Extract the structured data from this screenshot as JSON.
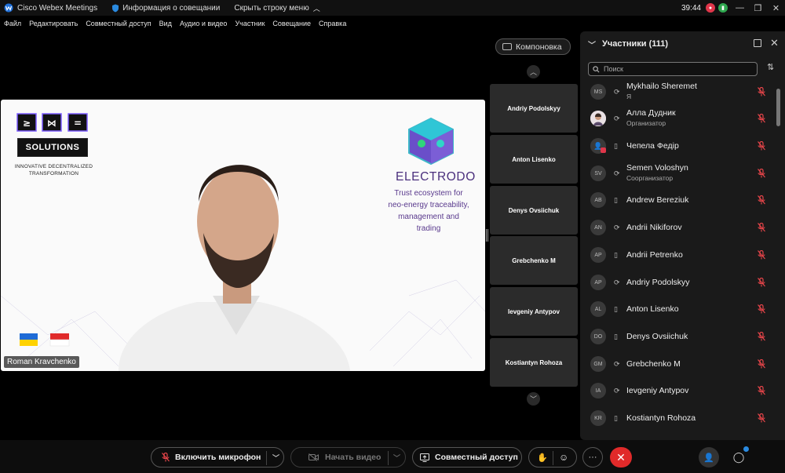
{
  "titlebar": {
    "app_title": "Cisco Webex Meetings",
    "meeting_info": "Информация о совещании",
    "hide_menu": "Скрыть строку меню",
    "clock": "39:44"
  },
  "menu": [
    "Файл",
    "Редактировать",
    "Совместный доступ",
    "Вид",
    "Аудио и видео",
    "Участник",
    "Совещание",
    "Справка"
  ],
  "layout_button": "Компоновка",
  "main_video": {
    "speaker_name": "Roman Kravchenko",
    "slide": {
      "solutions": "SOLUTIONS",
      "tagline_1": "INNOVATIVE DECENTRALIZED",
      "tagline_2": "TRANSFORMATION",
      "electrodo_title": "ELECTRODO",
      "electrodo_sub_1": "Trust ecosystem for",
      "electrodo_sub_2": "neo-energy  traceability,",
      "electrodo_sub_3": "management and",
      "electrodo_sub_4": "trading"
    }
  },
  "thumbnails": [
    "Andriy Podolskyy",
    "Anton Lisenko",
    "Denys Ovsiichuk",
    "Grebchenko M",
    "Ievgeniy Antypov",
    "Kostiantyn Rohoza"
  ],
  "panel": {
    "title": "Участники (111)",
    "search_placeholder": "Поиск",
    "participants": [
      {
        "initials": "MS",
        "name": "Mykhailo Sheremet",
        "role": "Я",
        "device": "sync"
      },
      {
        "initials": "",
        "name": "Алла Дудник",
        "role": "Организатор",
        "device": "sync"
      },
      {
        "initials": "",
        "name": "Чепела Федір",
        "role": "",
        "device": "phone"
      },
      {
        "initials": "SV",
        "name": "Semen Voloshyn",
        "role": "Соорганизатор",
        "device": "sync"
      },
      {
        "initials": "AB",
        "name": "Andrew Bereziuk",
        "role": "",
        "device": "phone"
      },
      {
        "initials": "AN",
        "name": "Andrii Nikiforov",
        "role": "",
        "device": "sync"
      },
      {
        "initials": "AP",
        "name": "Andrii Petrenko",
        "role": "",
        "device": "phone"
      },
      {
        "initials": "AP",
        "name": "Andriy Podolskyy",
        "role": "",
        "device": "sync"
      },
      {
        "initials": "AL",
        "name": "Anton Lisenko",
        "role": "",
        "device": "phone"
      },
      {
        "initials": "DO",
        "name": "Denys Ovsiichuk",
        "role": "",
        "device": "phone"
      },
      {
        "initials": "GM",
        "name": "Grebchenko M",
        "role": "",
        "device": "sync"
      },
      {
        "initials": "IA",
        "name": "Ievgeniy Antypov",
        "role": "",
        "device": "sync"
      },
      {
        "initials": "KR",
        "name": "Kostiantyn Rohoza",
        "role": "",
        "device": "phone"
      }
    ]
  },
  "toolbar": {
    "mic": "Включить микрофон",
    "video": "Начать видео",
    "share": "Совместный доступ",
    "more": "···"
  },
  "colors": {
    "mute_red": "#e8454a",
    "end_red": "#e02a2a",
    "electrodo_purple": "#4a2f7d"
  }
}
